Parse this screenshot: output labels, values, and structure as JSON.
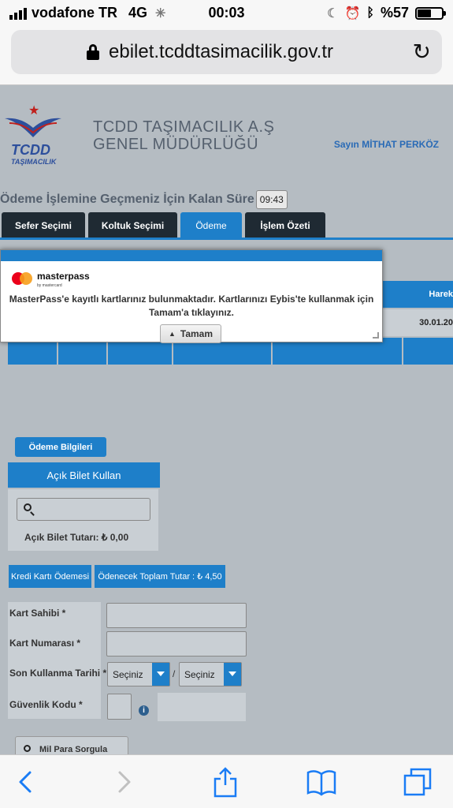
{
  "status_bar": {
    "carrier": "vodafone TR",
    "network": "4G",
    "time": "00:03",
    "battery": "%57",
    "battery_level": 0.57
  },
  "browser": {
    "url": "ebilet.tcddtasimacilik.gov.tr"
  },
  "header": {
    "logo_text": "TCDD",
    "logo_sub": "TAŞIMACILIK",
    "company_line1": "TCDD TAŞIMACILIK A.Ş",
    "company_line2": "GENEL MÜDÜRLÜĞÜ",
    "greeting": "Sayın MİTHAT PERKÖZ"
  },
  "timer": {
    "label": "Ödeme İşlemine Geçmeniz İçin Kalan Süre",
    "value": "09:43"
  },
  "tabs": [
    {
      "label": "Sefer Seçimi"
    },
    {
      "label": "Koltuk Seçimi"
    },
    {
      "label": "Ödeme"
    },
    {
      "label": "İşlem Özeti"
    }
  ],
  "background_table": {
    "header_partial": "Harek",
    "date_partial": "30.01.20"
  },
  "modal": {
    "brand": "masterpass",
    "brand_sub": "by mastercard",
    "message": "MasterPass'e kayıtlı kartlarınız bulunmaktadır. Kartlarınızı Eybis'te kullanmak için Tamam'a tıklayınız.",
    "ok_label": "Tamam"
  },
  "payment": {
    "section_button": "Ödeme Bilgileri",
    "open_ticket_button": "Açık Bilet Kullan",
    "open_ticket_amount": "Açık Bilet Tutarı: ₺ 0,00",
    "credit_card_tab": "Kredi Kartı Ödemesi",
    "total_amount": "Ödenecek Toplam Tutar : ₺ 4,50",
    "card_holder_label": "Kart Sahibi *",
    "card_number_label": "Kart Numarası *",
    "expiry_label": "Son Kullanma Tarihi *",
    "expiry_month": "Seçiniz",
    "expiry_separator": "/",
    "expiry_year": "Seçiniz",
    "cvv_label": "Güvenlik Kodu *",
    "mil_button": "Mil Para Sorgula"
  }
}
